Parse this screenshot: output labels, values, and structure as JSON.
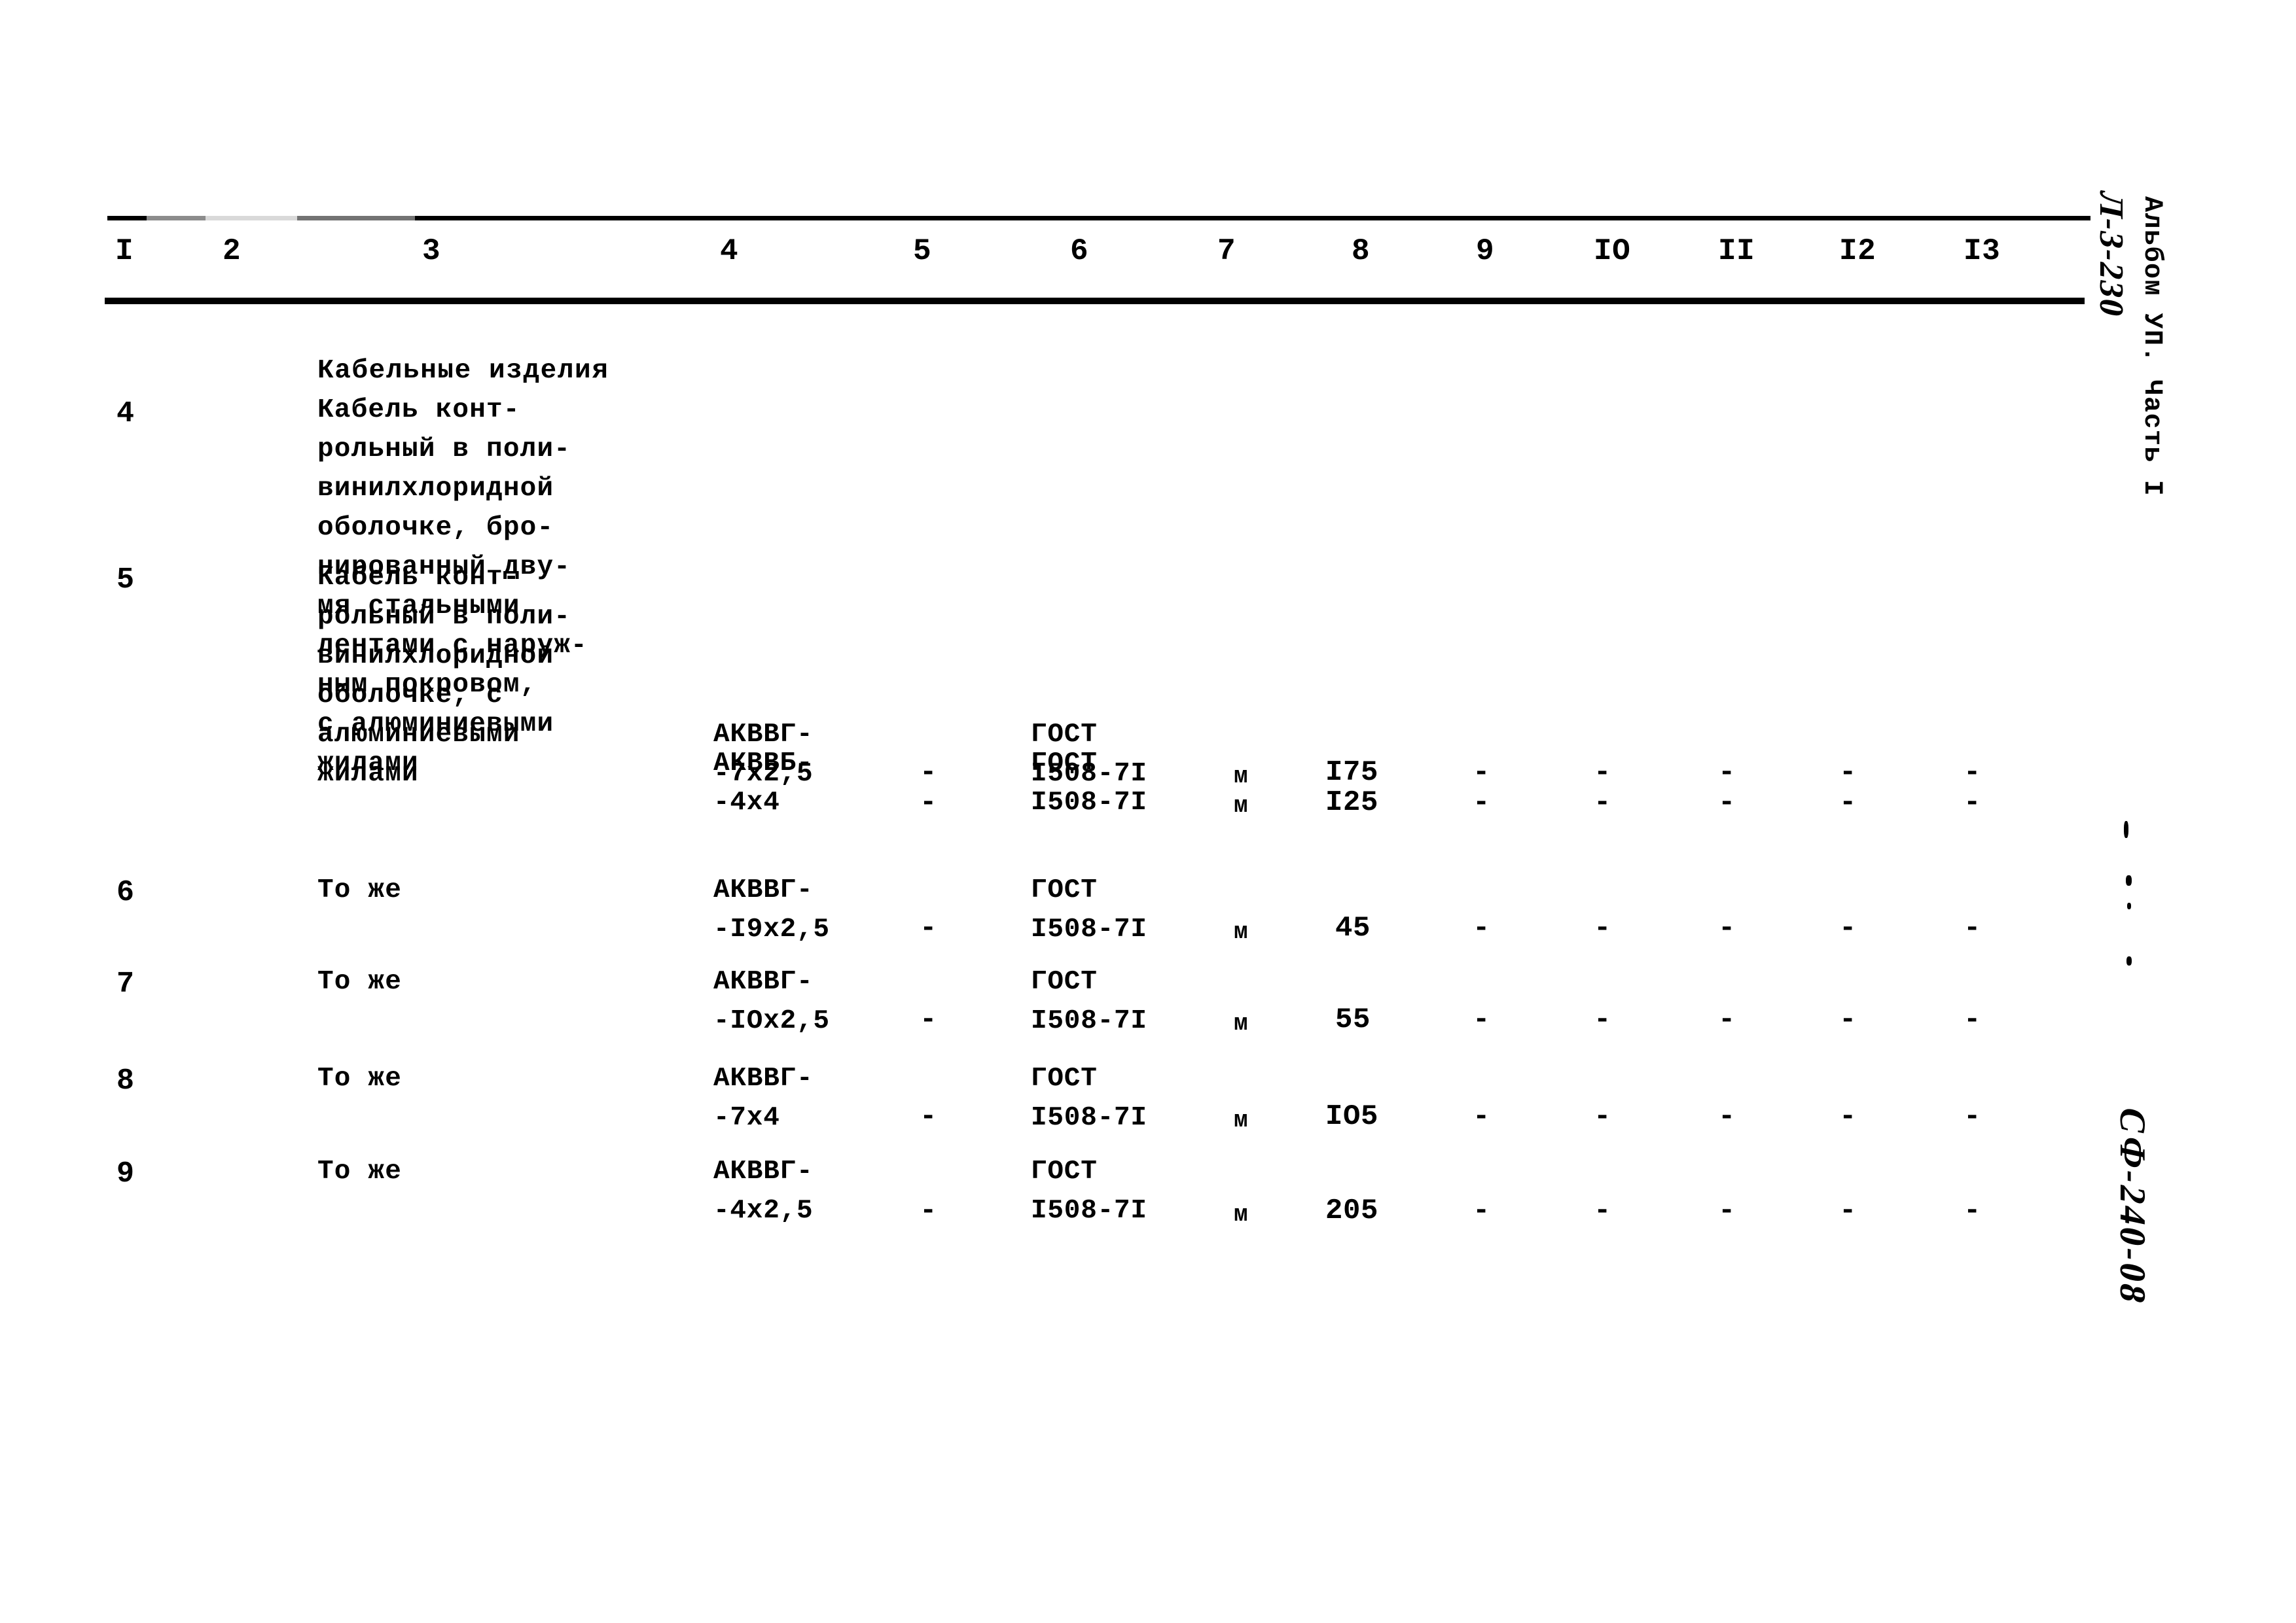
{
  "document": {
    "column_headers": [
      "I",
      "2",
      "3",
      "4",
      "5",
      "6",
      "7",
      "8",
      "9",
      "IO",
      "II",
      "I2",
      "I3"
    ],
    "section_title": "Кабельные изделия",
    "rows": [
      {
        "num": "4",
        "description": "Кабель конт-\nрольный в поли-\nвинилхлоридной\nоболочке, бро-\nнированный дву-\nмя стальными\nлентами с наруж-\nным покровом,\nс алюминиевыми\nжилами",
        "code": "АКВВБ-\n-4х4",
        "col5": "-",
        "gost": "ГОСТ\nI508-7I",
        "unit": "м",
        "qty": "I25",
        "col9": "-",
        "col10": "-",
        "col11": "-",
        "col12": "-",
        "col13": "-"
      },
      {
        "num": "5",
        "description": "Кабель конт-\nрольный в поли-\nвинилхлоридной\nоболочке, с\nалюминиевыми\nжилами",
        "code": "АКВВГ-\n-7х2,5",
        "col5": "-",
        "gost": "ГОСТ\nI508-7I",
        "unit": "м",
        "qty": "I75",
        "col9": "-",
        "col10": "-",
        "col11": "-",
        "col12": "-",
        "col13": "-"
      },
      {
        "num": "6",
        "description": "То же",
        "code": "АКВВГ-\n-I9х2,5",
        "col5": "-",
        "gost": "ГОСТ\nI508-7I",
        "unit": "м",
        "qty": "45",
        "col9": "-",
        "col10": "-",
        "col11": "-",
        "col12": "-",
        "col13": "-"
      },
      {
        "num": "7",
        "description": "То же",
        "code": "АКВВГ-\n-IОх2,5",
        "col5": "-",
        "gost": "ГОСТ\nI508-7I",
        "unit": "м",
        "qty": "55",
        "col9": "-",
        "col10": "-",
        "col11": "-",
        "col12": "-",
        "col13": "-"
      },
      {
        "num": "8",
        "description": "То же",
        "code": "АКВВГ-\n-7х4",
        "col5": "-",
        "gost": "ГОСТ\nI508-7I",
        "unit": "м",
        "qty": "IО5",
        "col9": "-",
        "col10": "-",
        "col11": "-",
        "col12": "-",
        "col13": "-"
      },
      {
        "num": "9",
        "description": "То же",
        "code": "АКВВГ-\n-4х2,5",
        "col5": "-",
        "gost": "ГОСТ\nI508-7I",
        "unit": "м",
        "qty": "205",
        "col9": "-",
        "col10": "-",
        "col11": "-",
        "col12": "-",
        "col13": "-"
      }
    ]
  },
  "margin_notes": {
    "top_handwritten": "Л-3-230",
    "top_printed": "Альбом УП. Часть I",
    "bottom_handwritten": "СФ-240-08"
  }
}
